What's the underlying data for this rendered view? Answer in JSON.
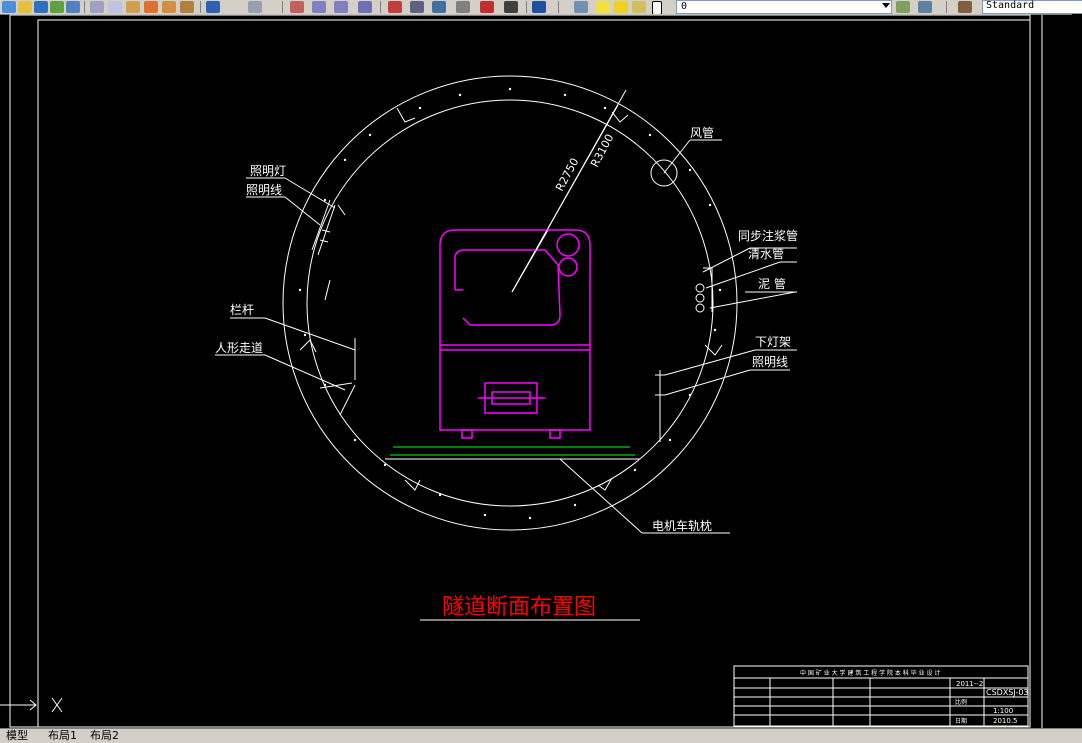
{
  "toolbar": {
    "layer_value": "0",
    "text_style_value": "Standard",
    "icons": [
      "new-icon",
      "open-icon",
      "save-icon",
      "plot-icon",
      "cut-icon",
      "copy-icon",
      "paste-icon",
      "match-properties-icon",
      "undo-icon",
      "redo-icon",
      "pan-icon",
      "zoom-realtime-icon",
      "zoom-window-icon",
      "zoom-previous-icon",
      "properties-icon",
      "design-center-icon",
      "tool-palettes-icon",
      "sheet-set-icon",
      "markup-icon",
      "calculator-icon",
      "help-icon",
      "layer-manager-icon",
      "layer-state-icon",
      "layer-previous-icon",
      "text-style-icon"
    ]
  },
  "drawing": {
    "title": "隧道断面布置图",
    "dimension_r1": "R2750",
    "dimension_r2": "R3100",
    "labels": {
      "air_duct": "风管",
      "sync_grout_pipe": "同步注浆管",
      "clean_water_pipe": "清水管",
      "mud_pipe": "泥 管",
      "lower_lamp_rack": "下灯架",
      "lighting_line_right": "照明线",
      "lighting_lamp": "照明灯",
      "lighting_line_left": "照明线",
      "railing": "栏杆",
      "walkway": "人形走道",
      "rail_sleeper": "电机车轨枕"
    }
  },
  "title_block": {
    "header": "中 国 矿 业 大 学 建 筑 工 程 学 院 本 科 毕 业 设 计",
    "drawing_no": "CSDXSJ-03",
    "scale": "1:100",
    "date": "2010.5",
    "project_no": "2011--2",
    "scale_label": "比例",
    "date_label": "日期"
  },
  "tabs": [
    "模型",
    "布局1",
    "布局2"
  ],
  "colors": {
    "white": "#ffffff",
    "magenta": "#ff00ff",
    "green": "#00ff00",
    "red": "#ff0000",
    "toolbar": "#d4d0c8"
  }
}
